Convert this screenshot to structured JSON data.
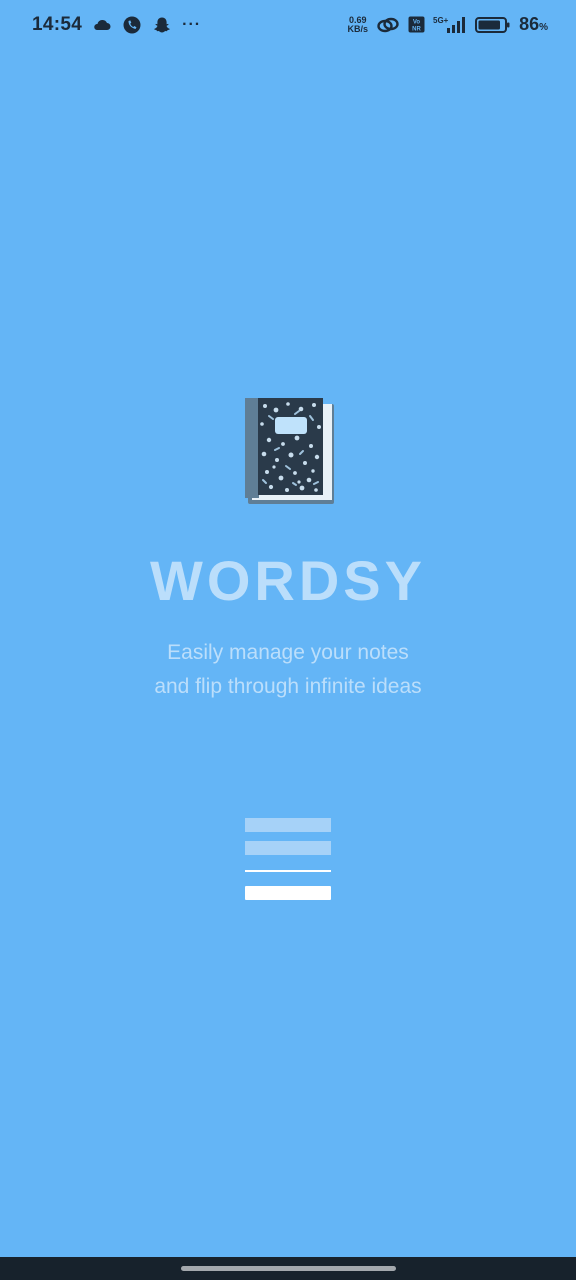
{
  "status_bar": {
    "time": "14:54",
    "left_icons": [
      "cloud-icon",
      "phone-call-icon",
      "snapchat-icon",
      "more-dots-icon"
    ],
    "more_glyph": "···",
    "net_speed_value": "0.69",
    "net_speed_unit": "KB/s",
    "volte_label": "Vo NR",
    "network_type": "5G+",
    "battery_percent": "86",
    "battery_percent_sign": "%",
    "battery_level": 0.86
  },
  "splash": {
    "icon": "notebook-icon",
    "title": "WORDSY",
    "tagline_line1": "Easily manage your notes",
    "tagline_line2": "and flip through infinite ideas"
  },
  "colors": {
    "background": "#64b5f6",
    "title": "#bbdefb",
    "nav_bar": "#17222c"
  }
}
